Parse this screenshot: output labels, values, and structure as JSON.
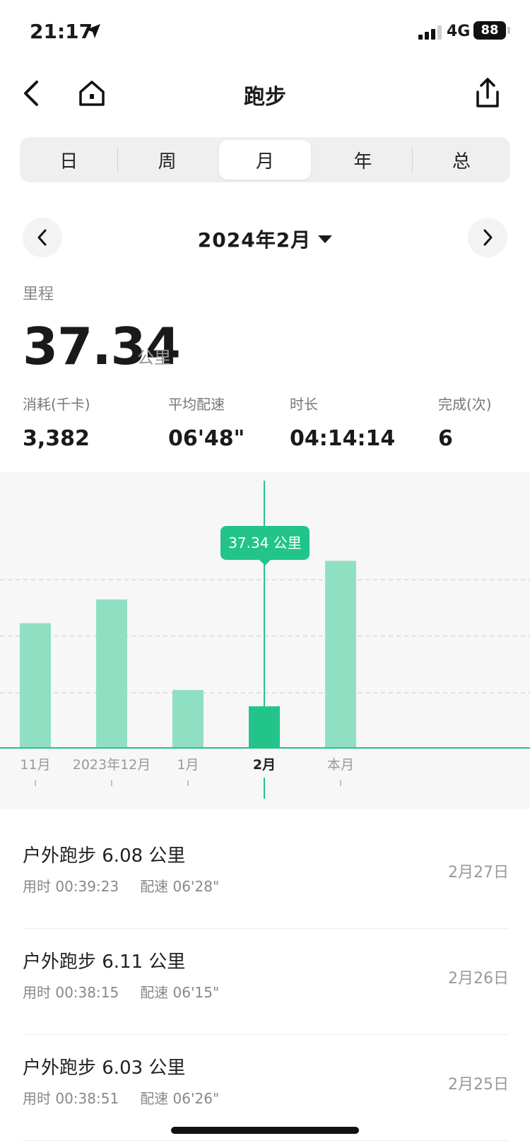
{
  "status": {
    "time": "21:17",
    "network": "4G",
    "battery": "88"
  },
  "nav": {
    "title": "跑步"
  },
  "tabs": [
    {
      "label": "日",
      "active": false
    },
    {
      "label": "周",
      "active": false
    },
    {
      "label": "月",
      "active": true
    },
    {
      "label": "年",
      "active": false
    },
    {
      "label": "总",
      "active": false
    }
  ],
  "month_selector": {
    "label": "2024年2月"
  },
  "distance": {
    "label": "里程",
    "value": "37.34",
    "unit": "公里"
  },
  "stats": [
    {
      "key": "消耗(千卡)",
      "value": "3,382"
    },
    {
      "key": "平均配速",
      "value": "06'48\""
    },
    {
      "key": "时长",
      "value": "04:14:14"
    },
    {
      "key": "完成(次)",
      "value": "6"
    }
  ],
  "chart_data": {
    "type": "bar",
    "categories": [
      "11月",
      "2023年12月",
      "1月",
      "2月",
      "本月"
    ],
    "values": [
      42,
      50,
      19.5,
      14,
      63
    ],
    "selected_index": 3,
    "tooltip": "37.34 公里",
    "colors": {
      "bar": "#8fe0c2",
      "selected": "#22c48a",
      "line": "#22c48a"
    },
    "grid": true
  },
  "records": [
    {
      "title": "户外跑步 6.08 公里",
      "duration": "用时 00:39:23",
      "pace": "配速 06'28\"",
      "date": "2月27日"
    },
    {
      "title": "户外跑步 6.11 公里",
      "duration": "用时 00:38:15",
      "pace": "配速 06'15\"",
      "date": "2月26日"
    },
    {
      "title": "户外跑步 6.03 公里",
      "duration": "用时 00:38:51",
      "pace": "配速 06'26\"",
      "date": "2月25日"
    }
  ]
}
